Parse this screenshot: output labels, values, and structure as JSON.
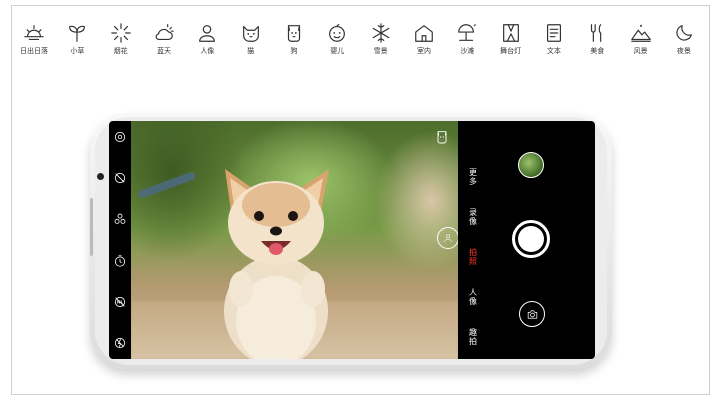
{
  "scenes": [
    {
      "label": "日出日落",
      "icon": "sunrise-icon"
    },
    {
      "label": "小草",
      "icon": "sprout-icon"
    },
    {
      "label": "烟花",
      "icon": "fireworks-icon"
    },
    {
      "label": "蓝天",
      "icon": "cloud-sun-icon"
    },
    {
      "label": "人像",
      "icon": "person-icon"
    },
    {
      "label": "猫",
      "icon": "cat-icon"
    },
    {
      "label": "狗",
      "icon": "dog-icon"
    },
    {
      "label": "婴儿",
      "icon": "baby-icon"
    },
    {
      "label": "雪景",
      "icon": "snowflake-icon"
    },
    {
      "label": "室内",
      "icon": "house-icon"
    },
    {
      "label": "沙滩",
      "icon": "beach-umbrella-icon"
    },
    {
      "label": "舞台灯",
      "icon": "stage-light-icon"
    },
    {
      "label": "文本",
      "icon": "document-icon"
    },
    {
      "label": "美食",
      "icon": "fork-knife-icon"
    },
    {
      "label": "风景",
      "icon": "mountain-icon"
    },
    {
      "label": "夜景",
      "icon": "moon-icon"
    }
  ],
  "camera": {
    "toolbar": [
      "settings-icon",
      "ai-off-icon",
      "filter-icon",
      "timer-icon",
      "hdr-off-icon",
      "flash-off-icon"
    ],
    "modes": [
      {
        "label": "更多",
        "active": false
      },
      {
        "label": "录像",
        "active": false
      },
      {
        "label": "拍照",
        "active": true
      },
      {
        "label": "人像",
        "active": false
      },
      {
        "label": "趣拍",
        "active": false
      }
    ],
    "scene_indicator": "dog-icon",
    "accent": "#ff3b30"
  }
}
